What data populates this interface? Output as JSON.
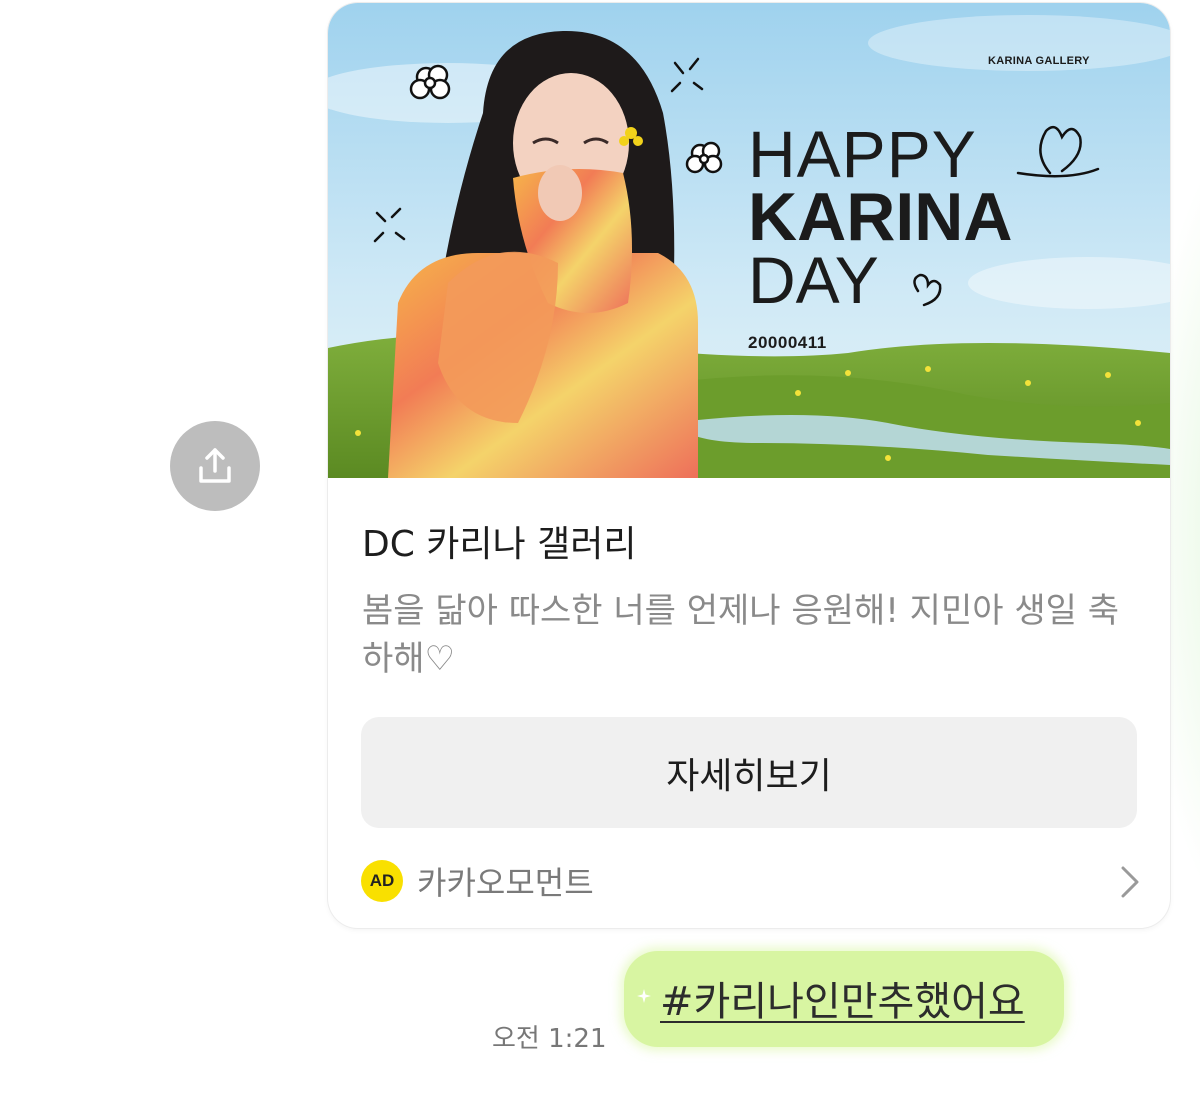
{
  "card": {
    "banner": {
      "gallery_tag": "KARINA GALLERY",
      "line1": "HAPPY",
      "line2": "KARINA",
      "line3": "DAY",
      "date": "20000411"
    },
    "title": "DC 카리나 갤러리",
    "description": "봄을 닮아 따스한 너를 언제나 응원해! 지민아 생일 축하해♡",
    "button_label": "자세히보기",
    "footer": {
      "badge": "AD",
      "label": "카카오모먼트"
    }
  },
  "message": {
    "text": "#카리나인만추했어요",
    "time": "오전 1:21"
  },
  "colors": {
    "bubble": "#d8f5a2",
    "ad_badge": "#f9e000",
    "share_button": "#bdbdbd"
  },
  "icons": [
    "share-icon",
    "chevron-right-icon",
    "flower-icon",
    "heart-icon",
    "sparkle-icon"
  ]
}
